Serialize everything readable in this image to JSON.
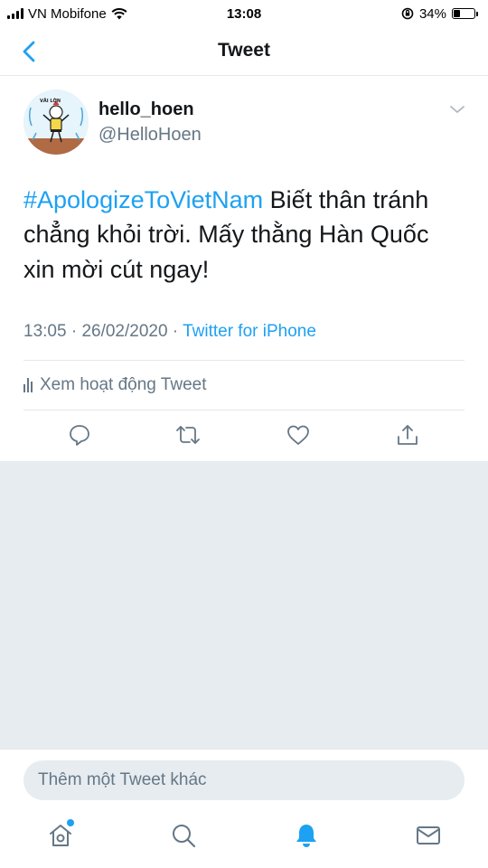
{
  "status_bar": {
    "carrier": "VN Mobifone",
    "time": "13:08",
    "battery_percent": "34%",
    "battery_level": 0.34,
    "icons": [
      "signal-icon",
      "wifi-icon",
      "orientation-lock-icon",
      "battery-icon"
    ]
  },
  "nav": {
    "title": "Tweet",
    "back_icon": "chevron-left-icon"
  },
  "tweet": {
    "author_name": "hello_hoen",
    "author_handle": "@HelloHoen",
    "avatar_text": "VĂI LỜN",
    "hashtag": "#ApologizeToVietNam",
    "body": " Biết thân tránh chẳng khỏi trời. Mấy thằng Hàn Quốc xin mời cút ngay!",
    "time": "13:05",
    "separator1": " · ",
    "date": "26/02/2020",
    "separator2": " · ",
    "source": "Twitter for iPhone",
    "activity_label": "Xem hoạt động Tweet"
  },
  "actions": [
    "reply-icon",
    "retweet-icon",
    "like-icon",
    "share-icon"
  ],
  "reply": {
    "placeholder": "Thêm một Tweet khác"
  },
  "tabs": [
    "home-icon",
    "search-icon",
    "notifications-icon",
    "messages-icon"
  ],
  "colors": {
    "accent": "#1da1f2",
    "text": "#14171a",
    "secondary": "#657786",
    "background_gray": "#e6ecf0"
  }
}
